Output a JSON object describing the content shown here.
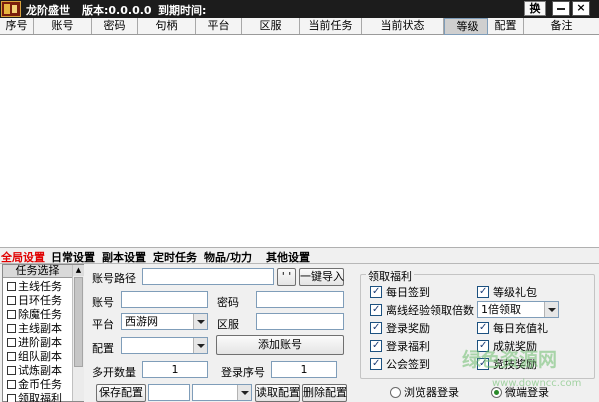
{
  "titlebar": {
    "app_name": "龙阶盛世",
    "version": "版本:0.0.0.0",
    "expiry_label": "到期时间:",
    "switch_label": "换",
    "close_label": "×"
  },
  "grid": {
    "columns": [
      "序号",
      "账号",
      "密码",
      "句柄",
      "平台",
      "区服",
      "当前任务",
      "当前状态",
      "等级",
      "配置",
      "备注"
    ]
  },
  "tabs": [
    "全局设置",
    "日常设置",
    "副本设置",
    "定时任务",
    "物品/功力",
    "其他设置"
  ],
  "task_list": {
    "title": "任务选择",
    "items": [
      "主线任务",
      "日环任务",
      "除魔任务",
      "主线副本",
      "进阶副本",
      "组队副本",
      "试炼副本",
      "金币任务",
      "领取福利"
    ]
  },
  "form": {
    "account_path_label": "账号路径",
    "account_path_value": "",
    "browse_button": "' '",
    "import_button": "一键导入",
    "account_label": "账号",
    "password_label": "密码",
    "platform_label": "平台",
    "platform_value": "西游网",
    "server_label": "区服",
    "config_label": "配置",
    "add_account_button": "添加账号",
    "multi_count_label": "多开数量",
    "multi_count_value": "1",
    "login_seq_label": "登录序号",
    "login_seq_value": "1",
    "save_config_button": "保存配置",
    "read_config_button": "读取配置",
    "delete_config_button": "删除配置"
  },
  "rewards": {
    "title": "领取福利",
    "items": [
      {
        "label": "每日签到",
        "checked": true
      },
      {
        "label": "等级礼包",
        "checked": true
      },
      {
        "label": "离线经验领取倍数",
        "checked": true
      },
      {
        "label": "登录奖励",
        "checked": true
      },
      {
        "label": "每日充值礼",
        "checked": true
      },
      {
        "label": "登录福利",
        "checked": true
      },
      {
        "label": "成就奖励",
        "checked": true
      },
      {
        "label": "公会签到",
        "checked": true
      },
      {
        "label": "竞技奖励",
        "checked": true
      }
    ],
    "offline_multiplier": "1倍领取"
  },
  "login_mode": {
    "browser_login": "浏览器登录",
    "micro_login": "微端登录",
    "selected": "微端登录"
  },
  "watermark": {
    "text": "绿色资源网",
    "url": "www.downcc.com"
  }
}
